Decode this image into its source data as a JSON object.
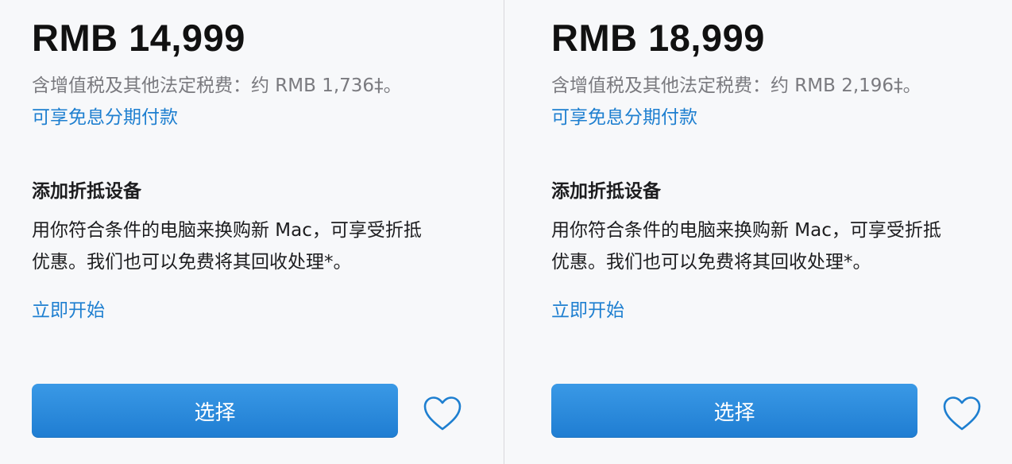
{
  "colors": {
    "accent": "#1e7fd0",
    "button": "#2a8ae0",
    "muted_text": "#7a7a7f"
  },
  "products": [
    {
      "price": "RMB 14,999",
      "tax_note": "含增值税及其他法定税费：约 RMB 1,736‡。",
      "installment_link": "可享免息分期付款",
      "tradein_title": "添加折抵设备",
      "tradein_desc_line1": "用你符合条件的电脑来换购新 Mac，可享受折抵",
      "tradein_desc_line2": "优惠。我们也可以免费将其回收处理*。",
      "start_link": "立即开始",
      "select_label": "选择",
      "favorite_icon": "heart-icon"
    },
    {
      "price": "RMB 18,999",
      "tax_note": "含增值税及其他法定税费：约 RMB 2,196‡。",
      "installment_link": "可享免息分期付款",
      "tradein_title": "添加折抵设备",
      "tradein_desc_line1": "用你符合条件的电脑来换购新 Mac，可享受折抵",
      "tradein_desc_line2": "优惠。我们也可以免费将其回收处理*。",
      "start_link": "立即开始",
      "select_label": "选择",
      "favorite_icon": "heart-icon"
    }
  ]
}
